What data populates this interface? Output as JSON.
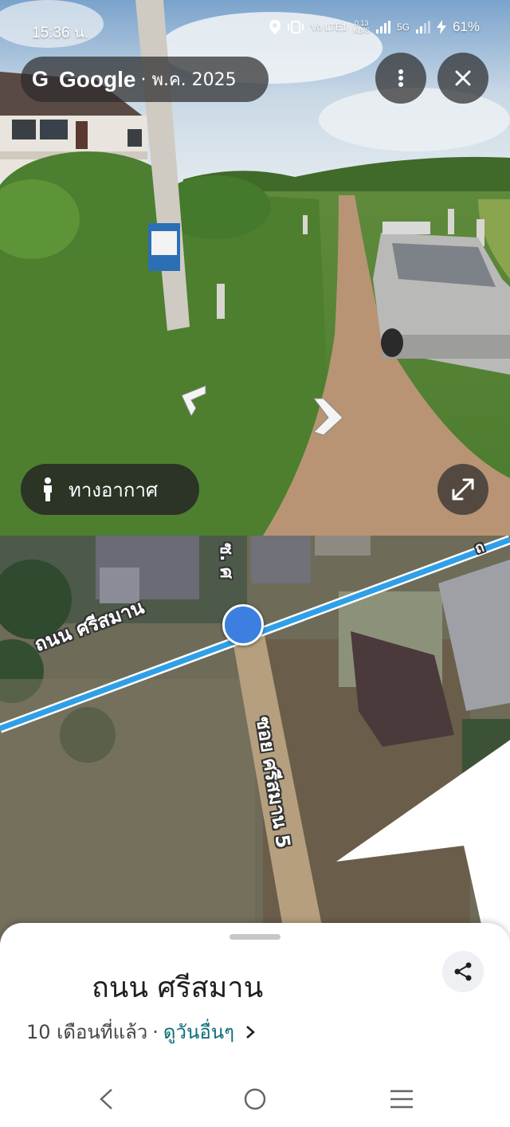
{
  "status_bar": {
    "time": "15:36 น.",
    "network_speed_value": "0.13",
    "network_speed_unit": "KB/S",
    "lte_label": "Vo LTE1",
    "signal_label": "5G",
    "battery": "61%"
  },
  "header": {
    "brand": "Google",
    "date": "· พ.ค. 2025",
    "menu_icon": "more-vert-icon",
    "close_icon": "close-icon"
  },
  "street_view": {
    "aerial_button_label": "ทางอากาศ",
    "aerial_icon": "person-icon",
    "expand_icon": "expand-icon"
  },
  "map": {
    "main_road_label": "ถนน ศรีสมาน",
    "soi_label": "ซอย ศรีสมาน 5",
    "top_label": "ซ. ศ",
    "top_right_label": "ถ"
  },
  "place": {
    "title": "ถนน ศรีสมาน",
    "age": "10 เดือนที่แล้ว",
    "separator": "·",
    "more_dates": "ดูวันอื่นๆ",
    "share_icon": "share-icon"
  },
  "colors": {
    "road_blue": "#2f9fe8",
    "pill_bg": "#2d2d2d",
    "link_teal": "#0b6e77",
    "pegman_blue": "#3c7fe0"
  }
}
